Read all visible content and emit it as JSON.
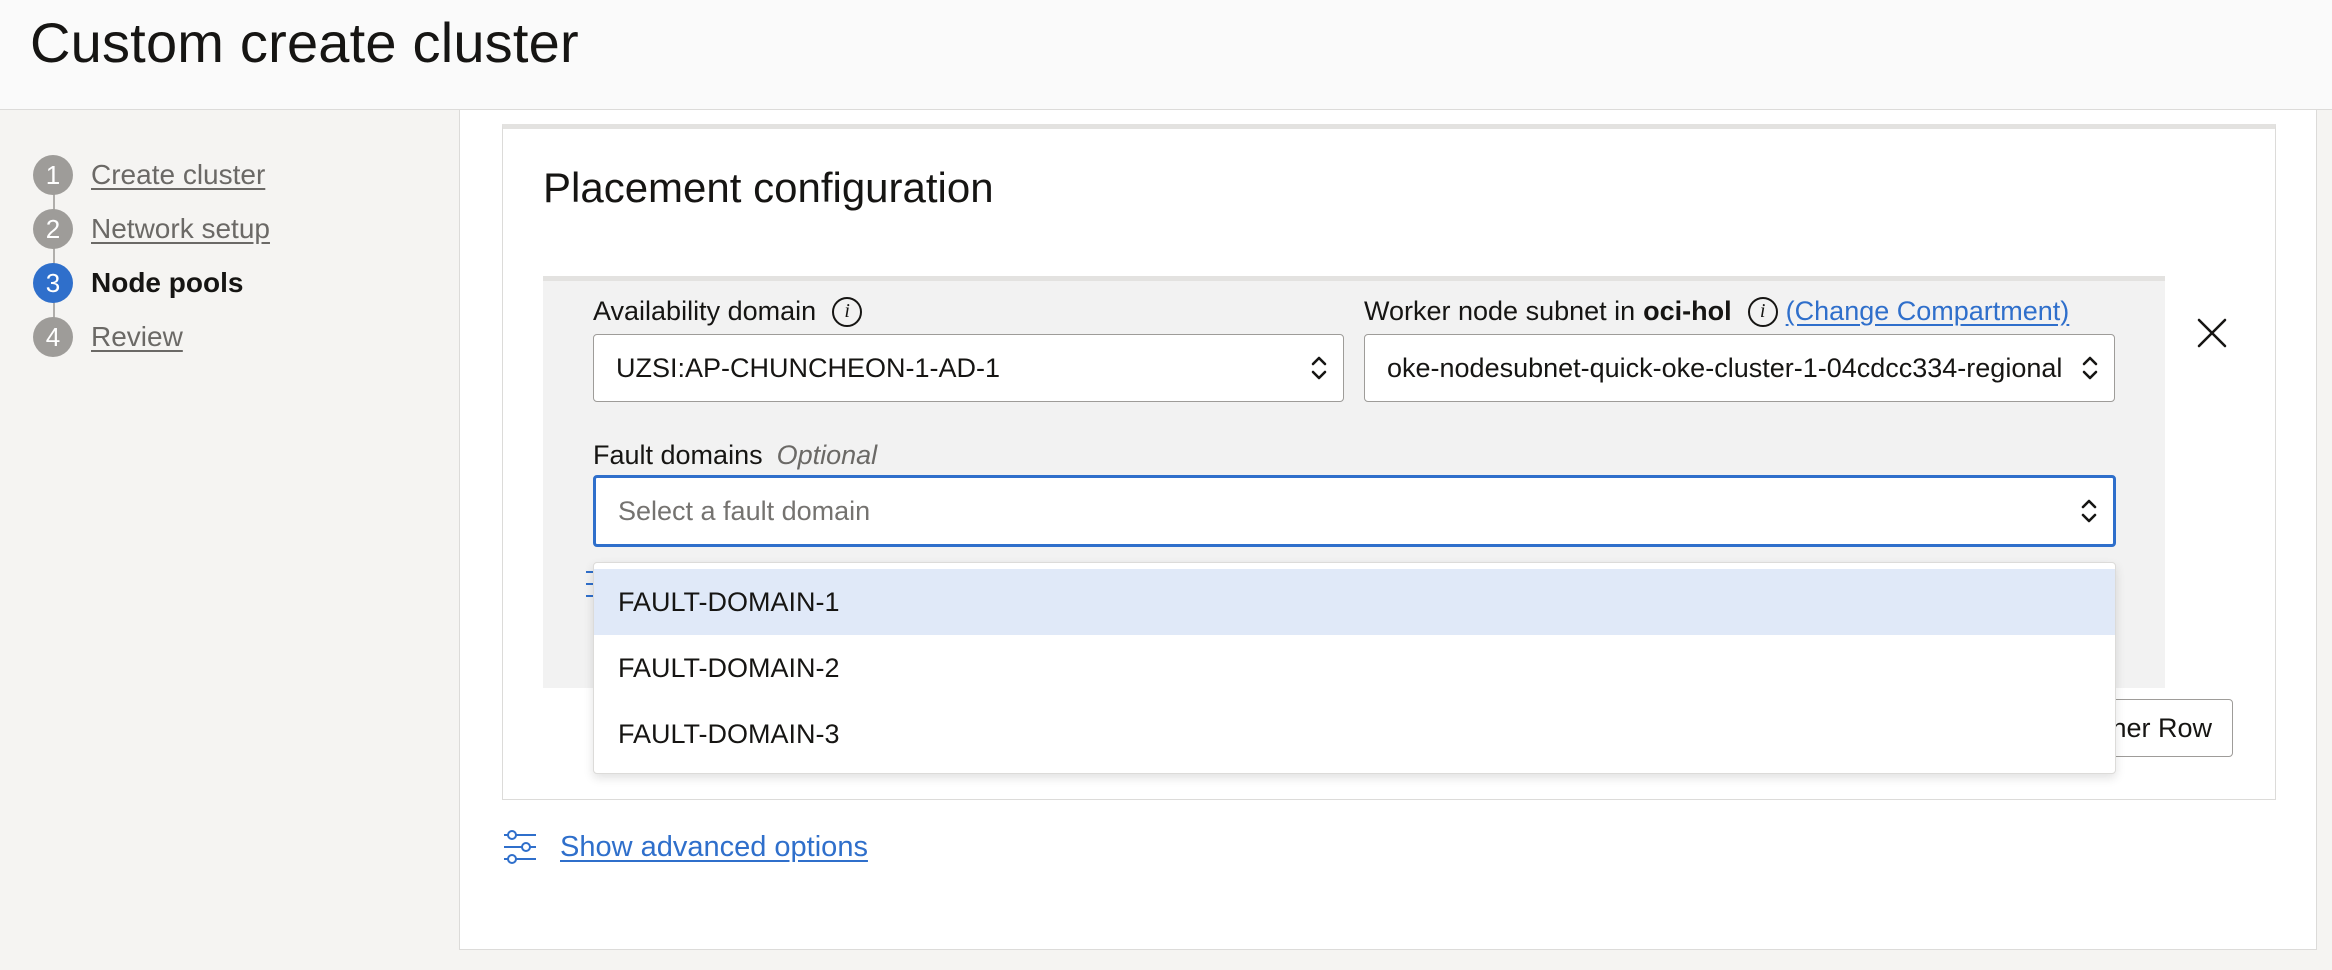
{
  "page": {
    "title": "Custom create cluster"
  },
  "steps": [
    {
      "num": "1",
      "label": "Create cluster",
      "state": "done"
    },
    {
      "num": "2",
      "label": "Network setup",
      "state": "done"
    },
    {
      "num": "3",
      "label": "Node pools",
      "state": "active"
    },
    {
      "num": "4",
      "label": "Review",
      "state": "pending"
    }
  ],
  "placement": {
    "title": "Placement configuration",
    "availability_domain": {
      "label": "Availability domain",
      "value": "UZSI:AP-CHUNCHEON-1-AD-1"
    },
    "worker_subnet": {
      "label_prefix": "Worker node subnet in",
      "compartment": "oci-hol",
      "change_link": "(Change Compartment)",
      "value": "oke-nodesubnet-quick-oke-cluster-1-04cdcc334-regional"
    },
    "fault_domains": {
      "label": "Fault domains",
      "optional": "Optional",
      "placeholder": "Select a fault domain",
      "options": [
        "FAULT-DOMAIN-1",
        "FAULT-DOMAIN-2",
        "FAULT-DOMAIN-3"
      ],
      "highlighted_index": 0
    },
    "another_row_button": "Another Row"
  },
  "advanced": {
    "link": "Show advanced options"
  },
  "colors": {
    "accent": "#2f6fcb",
    "highlight": "#e0e9f8",
    "step_inactive": "#9e9c99"
  },
  "icons": {
    "info": "info-icon",
    "close": "close-icon",
    "chevron": "updown-chevron-icon",
    "sliders": "sliders-icon"
  }
}
